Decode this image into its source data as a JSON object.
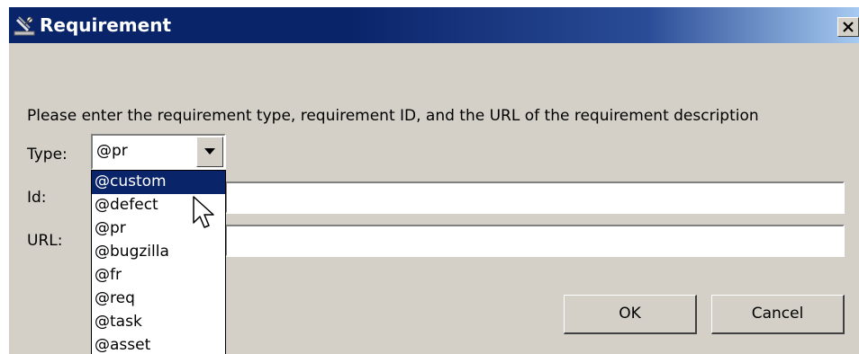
{
  "window": {
    "title": "Requirement",
    "icon": "satellite-icon",
    "close_icon": "close-icon"
  },
  "form": {
    "prompt": "Please enter the requirement type, requirement ID, and the URL of the requirement description",
    "type_label": "Type:",
    "type_value": "@pr",
    "id_label": "Id:",
    "id_value": "",
    "url_label": "URL:",
    "url_value": ""
  },
  "dropdown": {
    "options": [
      "@custom",
      "@defect",
      "@pr",
      "@bugzilla",
      "@fr",
      "@req",
      "@task",
      "@asset"
    ],
    "highlighted": "@custom"
  },
  "buttons": {
    "ok": "OK",
    "cancel": "Cancel"
  },
  "colors": {
    "title_bar": "#0a246a",
    "dialog_bg": "#d4d0c8",
    "selection": "#0a246a"
  }
}
